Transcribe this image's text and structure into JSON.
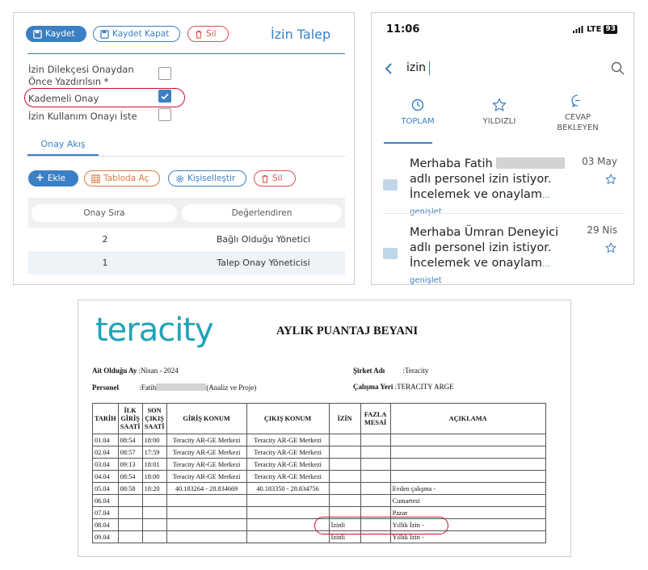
{
  "form": {
    "save_label": "Kaydet",
    "save_close_label": "Kaydet Kapat",
    "delete_label": "Sil",
    "title": "İzin Talep",
    "print_label_line1": "İzin Dilekçesi Onaydan",
    "print_label_line2": "Önce Yazdırılsın *",
    "print_checked": false,
    "stepped_label": "Kademeli Onay",
    "stepped_checked": true,
    "usage_label": "İzin Kullanım Onayı İste",
    "usage_checked": false,
    "tab_label": "Onay Akış",
    "add_label": "Ekle",
    "open_table_label": "Tabloda Aç",
    "personalize_label": "Kişiselleştir",
    "delete2_label": "Sil",
    "grid_headers": [
      "Onay Sıra",
      "Değerlendiren"
    ],
    "grid_rows": [
      {
        "order": "2",
        "evaluator": "Bağlı Olduğu Yönetici"
      },
      {
        "order": "1",
        "evaluator": "Talep Onay Yöneticisi"
      }
    ]
  },
  "mobile": {
    "time": "11:06",
    "network": "LTE",
    "battery": "93",
    "search_text": "izin",
    "tabs": [
      "TOPLAM",
      "YILDIZLI",
      "CEVAP BEKLEYEN"
    ],
    "mails": [
      {
        "text_before": "Merhaba Fatih",
        "text_after": "adlı personel izin istiyor. İncelemek ve onaylam",
        "more": "... genişlet",
        "date": "03 May"
      },
      {
        "text_before": "Merhaba Ümran Deneyici adlı personel izin istiyor. İncelemek ve onaylam",
        "text_after": "",
        "more": "... genişlet",
        "date": "29 Nis"
      }
    ]
  },
  "report": {
    "logo": "teracity",
    "title": "AYLIK PUANTAJ BEYANI",
    "period_label": "Ait Olduğu Ay",
    "period_value": ":Nisan - 2024",
    "personnel_label": "Personel",
    "personnel_prefix": ":Fatih",
    "personnel_suffix": "(Analiz ve Proje)",
    "company_label": "Şirket Adı",
    "company_value": ":Teracity",
    "workplace_label": "Çalışma Yeri",
    "workplace_value": ":TERACITY ARGE",
    "headers": [
      "TARİH",
      "İLK GİRİŞ SAATİ",
      "SON ÇIKIŞ SAATİ",
      "GİRİŞ KONUM",
      "ÇIKIŞ KONUM",
      "İZİN",
      "FAZLA MESAİ",
      "AÇIKLAMA"
    ],
    "rows": [
      [
        "01.04",
        "08:54",
        "18:00",
        "Teracity AR-GE Merkezi",
        "Teracity AR-GE Merkezi",
        "",
        "",
        ""
      ],
      [
        "02.04",
        "08:57",
        "17:59",
        "Teracity AR-GE Merkezi",
        "Teracity AR-GE Merkezi",
        "",
        "",
        ""
      ],
      [
        "03.04",
        "09:13",
        "18:01",
        "Teracity AR-GE Merkezi",
        "Teracity AR-GE Merkezi",
        "",
        "",
        ""
      ],
      [
        "04.04",
        "08:54",
        "18:00",
        "Teracity AR-GE Merkezi",
        "Teracity AR-GE Merkezi",
        "",
        "",
        ""
      ],
      [
        "05.04",
        "08:58",
        "18:20",
        "40.183264 - 28.834669",
        "40.183350 - 28.834756",
        "",
        "",
        "Evden çalışma -"
      ],
      [
        "06.04",
        "",
        "",
        "",
        "",
        "",
        "",
        "Cumartesi"
      ],
      [
        "07.04",
        "",
        "",
        "",
        "",
        "",
        "",
        "Pazar"
      ],
      [
        "08.04",
        "",
        "",
        "",
        "",
        "İzinli",
        "",
        "Yıllık İzin -"
      ],
      [
        "09.04",
        "",
        "",
        "",
        "",
        "İzinli",
        "",
        "Yıllık İzin -"
      ]
    ]
  }
}
